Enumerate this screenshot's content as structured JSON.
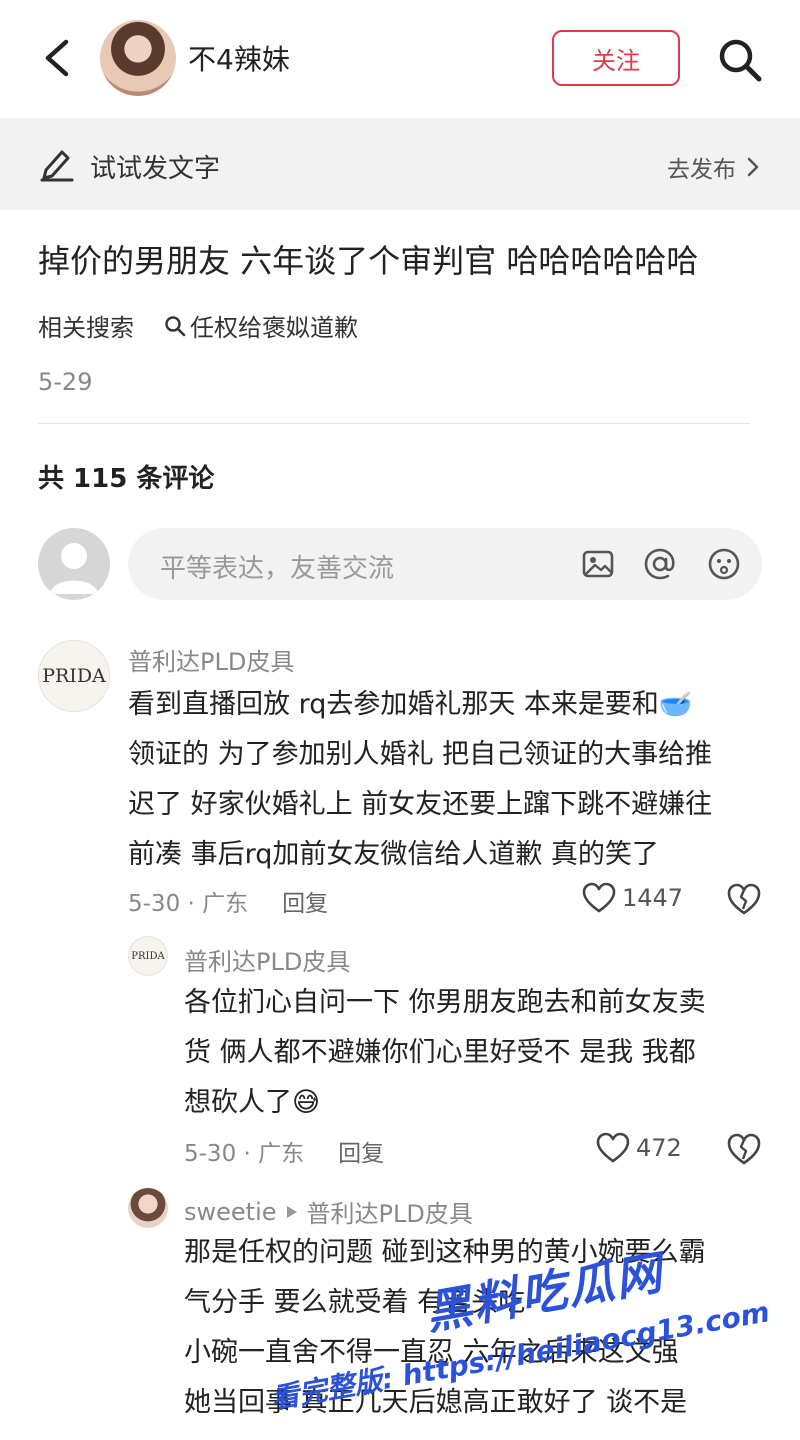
{
  "header": {
    "username": "不4辣妹",
    "follow_label": "关注"
  },
  "draft_bar": {
    "label": "试试发文字",
    "action": "去发布"
  },
  "post": {
    "title": "掉价的男朋友  六年谈了个审判官  哈哈哈哈哈哈",
    "related_label": "相关搜索",
    "related_query": "任权给褒姒道歉",
    "date": "5-29"
  },
  "comments_header": "共 115 条评论",
  "comment_input": {
    "placeholder": "平等表达，友善交流"
  },
  "comments": [
    {
      "avatar_text": "PRIDA",
      "author": "普利达PLD皮具",
      "lines": [
        "看到直播回放 rq去参加婚礼那天 本来是要和🥣",
        "领证的 为了参加别人婚礼 把自己领证的大事给推",
        "迟了 好家伙婚礼上 前女友还要上蹿下跳不避嫌往",
        "前凑 事后rq加前女友微信给人道歉 真的笑了"
      ],
      "meta": "5-30 · 广东",
      "reply_label": "回复",
      "likes": "1447"
    },
    {
      "avatar_text": "PRIDA",
      "author": "普利达PLD皮具",
      "lines": [
        "各位扪心自问一下 你男朋友跑去和前女友卖",
        "货 俩人都不避嫌你们心里好受不 是我 我都",
        "想砍人了😅"
      ],
      "meta": "5-30 · 广东",
      "reply_label": "回复",
      "likes": "472"
    },
    {
      "author": "sweetie",
      "reply_to": "普利达PLD皮具",
      "lines": [
        "那是任权的问题  碰到这种男的黄小婉要么霸",
        "气分手  要么就受着  有苦头吃",
        "小碗一直舍不得一直忍  六年之后来这文强",
        "她当回事  真正几天后媳高正敢好了  谈不是"
      ]
    }
  ],
  "watermark": {
    "brand": "黑料吃瓜网",
    "url_line": "看完整版: https://heiliaocg13.com"
  },
  "colors": {
    "accent": "#e0394a",
    "watermark": "#2b52d9"
  }
}
